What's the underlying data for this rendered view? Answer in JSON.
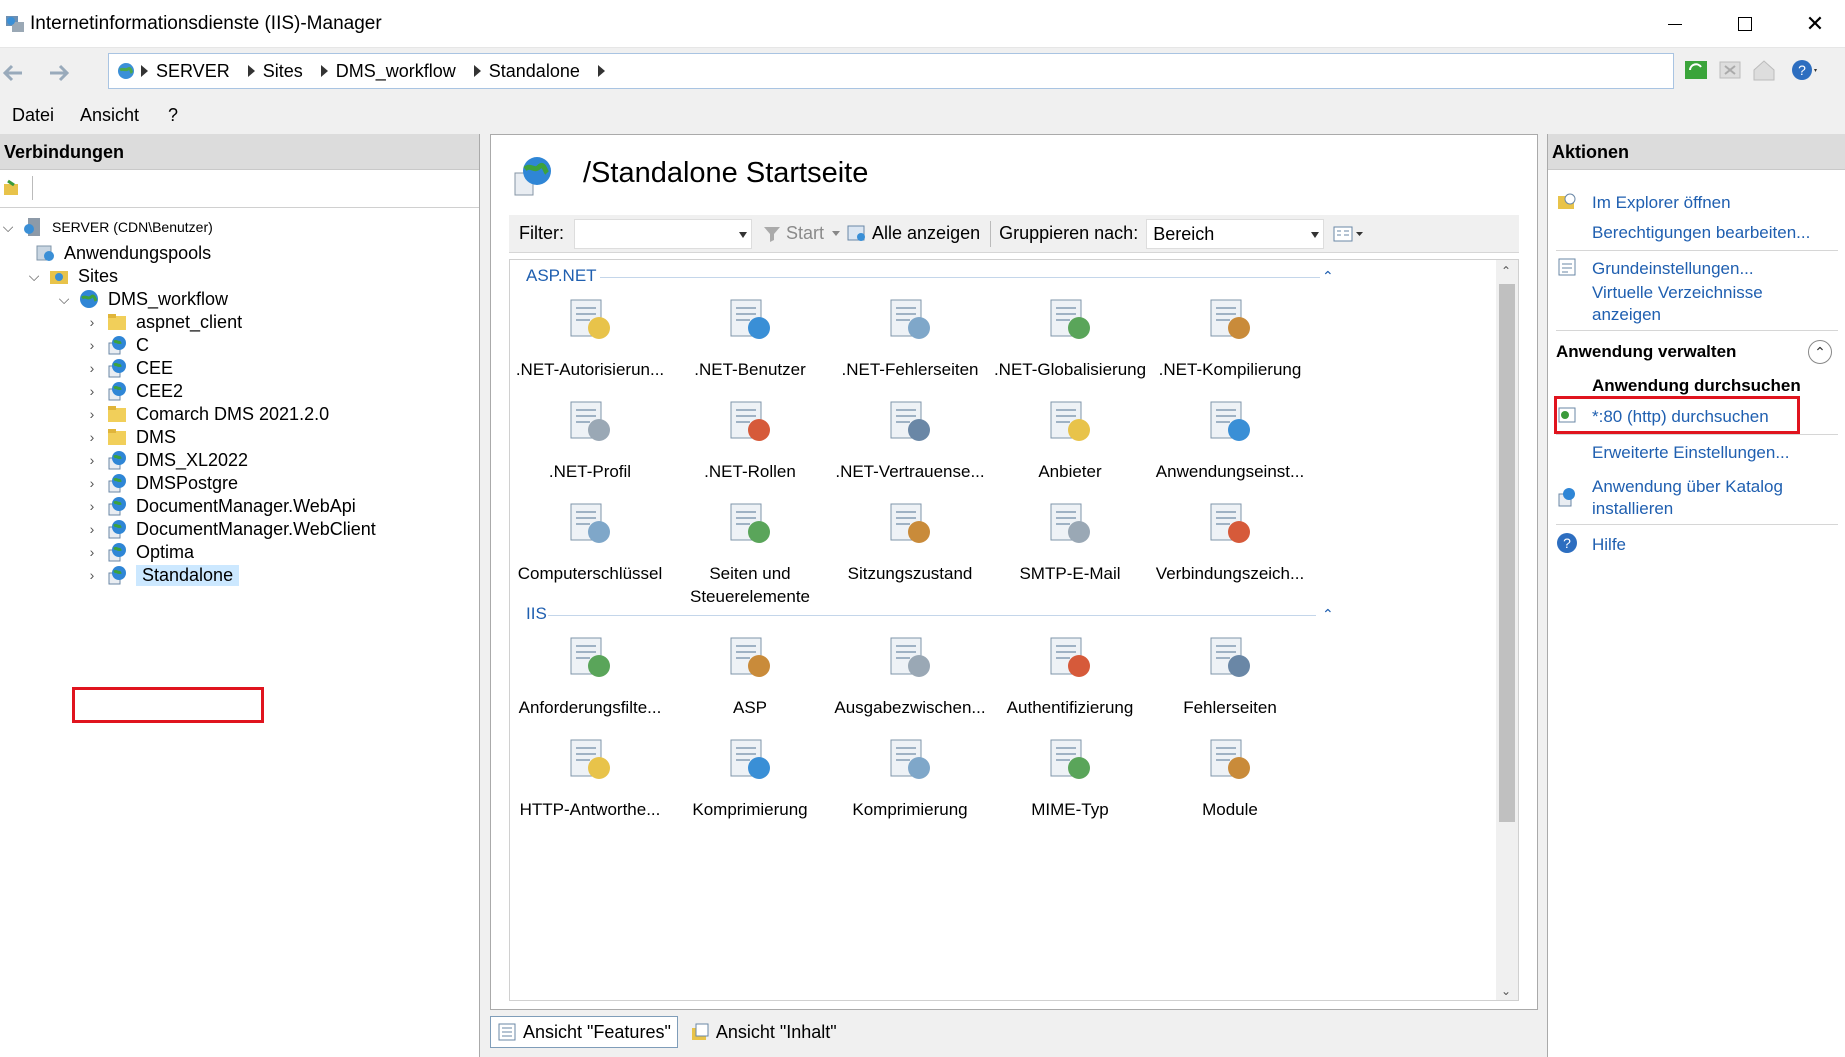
{
  "window": {
    "title": "Internetinformationsdienste (IIS)-Manager"
  },
  "address": {
    "crumbs": [
      "SERVER",
      "Sites",
      "DMS_workflow",
      "Standalone"
    ]
  },
  "menu": {
    "items": [
      "Datei",
      "Ansicht",
      "?"
    ]
  },
  "connections": {
    "header": "Verbindungen",
    "server": "SERVER (CDN\\Benutzer)",
    "app_pools": "Anwendungspools",
    "sites": "Sites",
    "site": "DMS_workflow",
    "children": [
      "aspnet_client",
      "C",
      "CEE",
      "CEE2",
      "Comarch DMS 2021.2.0",
      "DMS",
      "DMS_XL2022",
      "DMSPostgre",
      "DocumentManager.WebApi",
      "DocumentManager.WebClient",
      "Optima",
      "Standalone"
    ],
    "selected": "Standalone"
  },
  "main": {
    "title": "/Standalone Startseite",
    "filter": {
      "label": "Filter:",
      "value": "",
      "start": "Start",
      "show_all": "Alle anzeigen",
      "group_label": "Gruppieren nach:",
      "group_value": "Bereich"
    },
    "groups": [
      {
        "name": "ASP.NET",
        "features": [
          ".NET-Autorisierun...",
          ".NET-Benutzer",
          ".NET-Fehlerseiten",
          ".NET-Globalisierung",
          ".NET-Kompilierung",
          ".NET-Profil",
          ".NET-Rollen",
          ".NET-Vertrauense...",
          "Anbieter",
          "Anwendungseinst...",
          "Computerschlüssel",
          "Seiten und Steuerelemente",
          "Sitzungszustand",
          "SMTP-E-Mail",
          "Verbindungszeich..."
        ]
      },
      {
        "name": "IIS",
        "features": [
          "Anforderungsfilte...",
          "ASP",
          "Ausgabezwischen...",
          "Authentifizierung",
          "Fehlerseiten",
          "HTTP-Antworthe...",
          "Komprimierung",
          "Komprimierung",
          "MIME-Typ",
          "Module"
        ]
      }
    ],
    "tabs": {
      "features": "Ansicht \"Features\"",
      "content": "Ansicht \"Inhalt\""
    }
  },
  "actions": {
    "header": "Aktionen",
    "explore": "Im Explorer öffnen",
    "permissions": "Berechtigungen bearbeiten...",
    "basic_settings": "Grundeinstellungen...",
    "virtual_dirs": "Virtuelle Verzeichnisse anzeigen",
    "manage_app": "Anwendung verwalten",
    "browse_app": "Anwendung durchsuchen",
    "browse_80": "*:80 (http) durchsuchen",
    "advanced": "Erweiterte Einstellungen...",
    "install_catalog": "Anwendung über Katalog installieren",
    "help": "Hilfe"
  }
}
